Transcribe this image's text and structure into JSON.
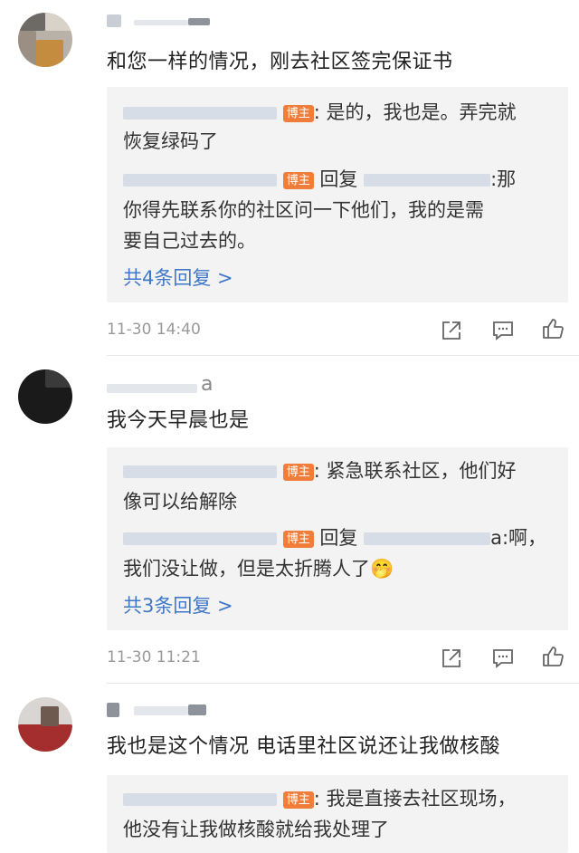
{
  "comments": [
    {
      "text": "和您一样的情况，刚去社区签完保证书",
      "replies": [
        {
          "badge": "博主",
          "lines": [
            ": 是的，我也是。弄完就",
            "恢复绿码了"
          ]
        },
        {
          "badge": "博主",
          "reply_word": "回复",
          "lines": [
            ":那",
            "你得先联系你的社区问一下他们，我的是需",
            "要自己过去的。"
          ]
        }
      ],
      "more": "共4条回复 >",
      "time": "11-30 14:40"
    },
    {
      "text": "我今天早晨也是",
      "username_suffix": "a",
      "replies": [
        {
          "badge": "博主",
          "lines": [
            ": 紧急联系社区，他们好",
            "像可以给解除"
          ]
        },
        {
          "badge": "博主",
          "reply_word": "回复",
          "lines": [
            "a:啊，",
            "我们没让做，但是太折腾人了🤭"
          ]
        }
      ],
      "more": "共3条回复 >",
      "time": "11-30 11:21"
    },
    {
      "text": "我也是这个情况 电话里社区说还让我做核酸",
      "replies": [
        {
          "badge": "博主",
          "lines": [
            ": 我是直接去社区现场，",
            "他没有让我做核酸就给我处理了"
          ]
        }
      ]
    }
  ],
  "icons": [
    "share-icon",
    "comment-icon",
    "like-icon"
  ]
}
